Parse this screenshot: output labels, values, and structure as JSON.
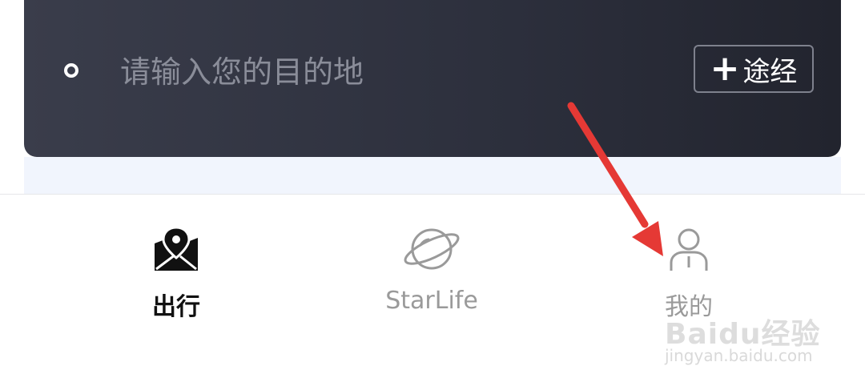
{
  "destination": {
    "placeholder": "请输入您的目的地",
    "waypoint_label": "途经"
  },
  "nav": {
    "tabs": [
      {
        "label": "出行",
        "icon": "map-pin-icon",
        "active": true
      },
      {
        "label": "StarLife",
        "icon": "planet-icon",
        "active": false
      },
      {
        "label": "我的",
        "icon": "person-icon",
        "active": false
      }
    ]
  },
  "annotation": {
    "arrow_color": "#e53935"
  },
  "watermark": {
    "brand": "Baidu经验",
    "url": "jingyan.baidu.com"
  },
  "colors": {
    "card_bg": "#2c2f3c",
    "active_tab": "#111111",
    "inactive_tab": "#9a9a9a"
  }
}
